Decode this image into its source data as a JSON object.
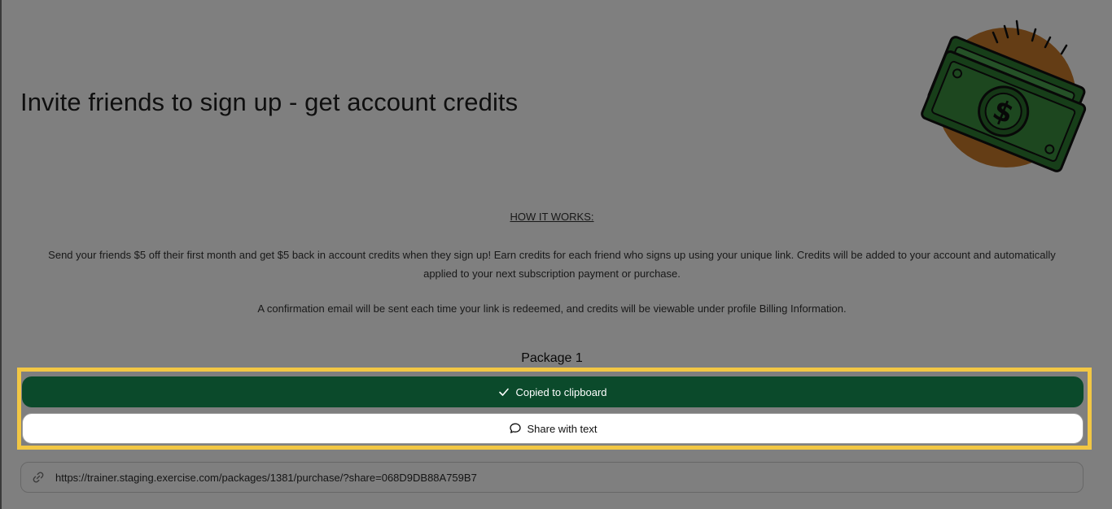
{
  "page": {
    "title": "Invite friends to sign up - get account credits",
    "illustration_icon": "dollar-bills-icon"
  },
  "how_it_works": {
    "heading": "HOW IT WORKS:",
    "paragraph1": "Send your friends $5 off their first month and get $5 back in account credits when they sign up! Earn credits for each friend who signs up using your unique link. Credits will be added to your account and automatically applied to your next subscription payment or purchase.",
    "paragraph2": "A confirmation email will be sent each time your link is redeemed, and credits will be viewable under profile Billing Information."
  },
  "package": {
    "title": "Package 1",
    "copied_button": {
      "label": "Copied to clipboard",
      "icon": "checkmark-icon"
    },
    "share_button": {
      "label": "Share with text",
      "icon": "chat-bubble-icon"
    },
    "share_link": {
      "value": "https://trainer.staging.exercise.com/packages/1381/purchase/?share=068D9DB88A759B7",
      "icon": "link-icon"
    }
  },
  "colors": {
    "primary_green": "#0b4a2b",
    "bill_green": "#2f7d32",
    "highlight": "#f2c744",
    "overlay": "rgba(0,0,0,0.5)",
    "coin_orange": "#c97a2a"
  }
}
